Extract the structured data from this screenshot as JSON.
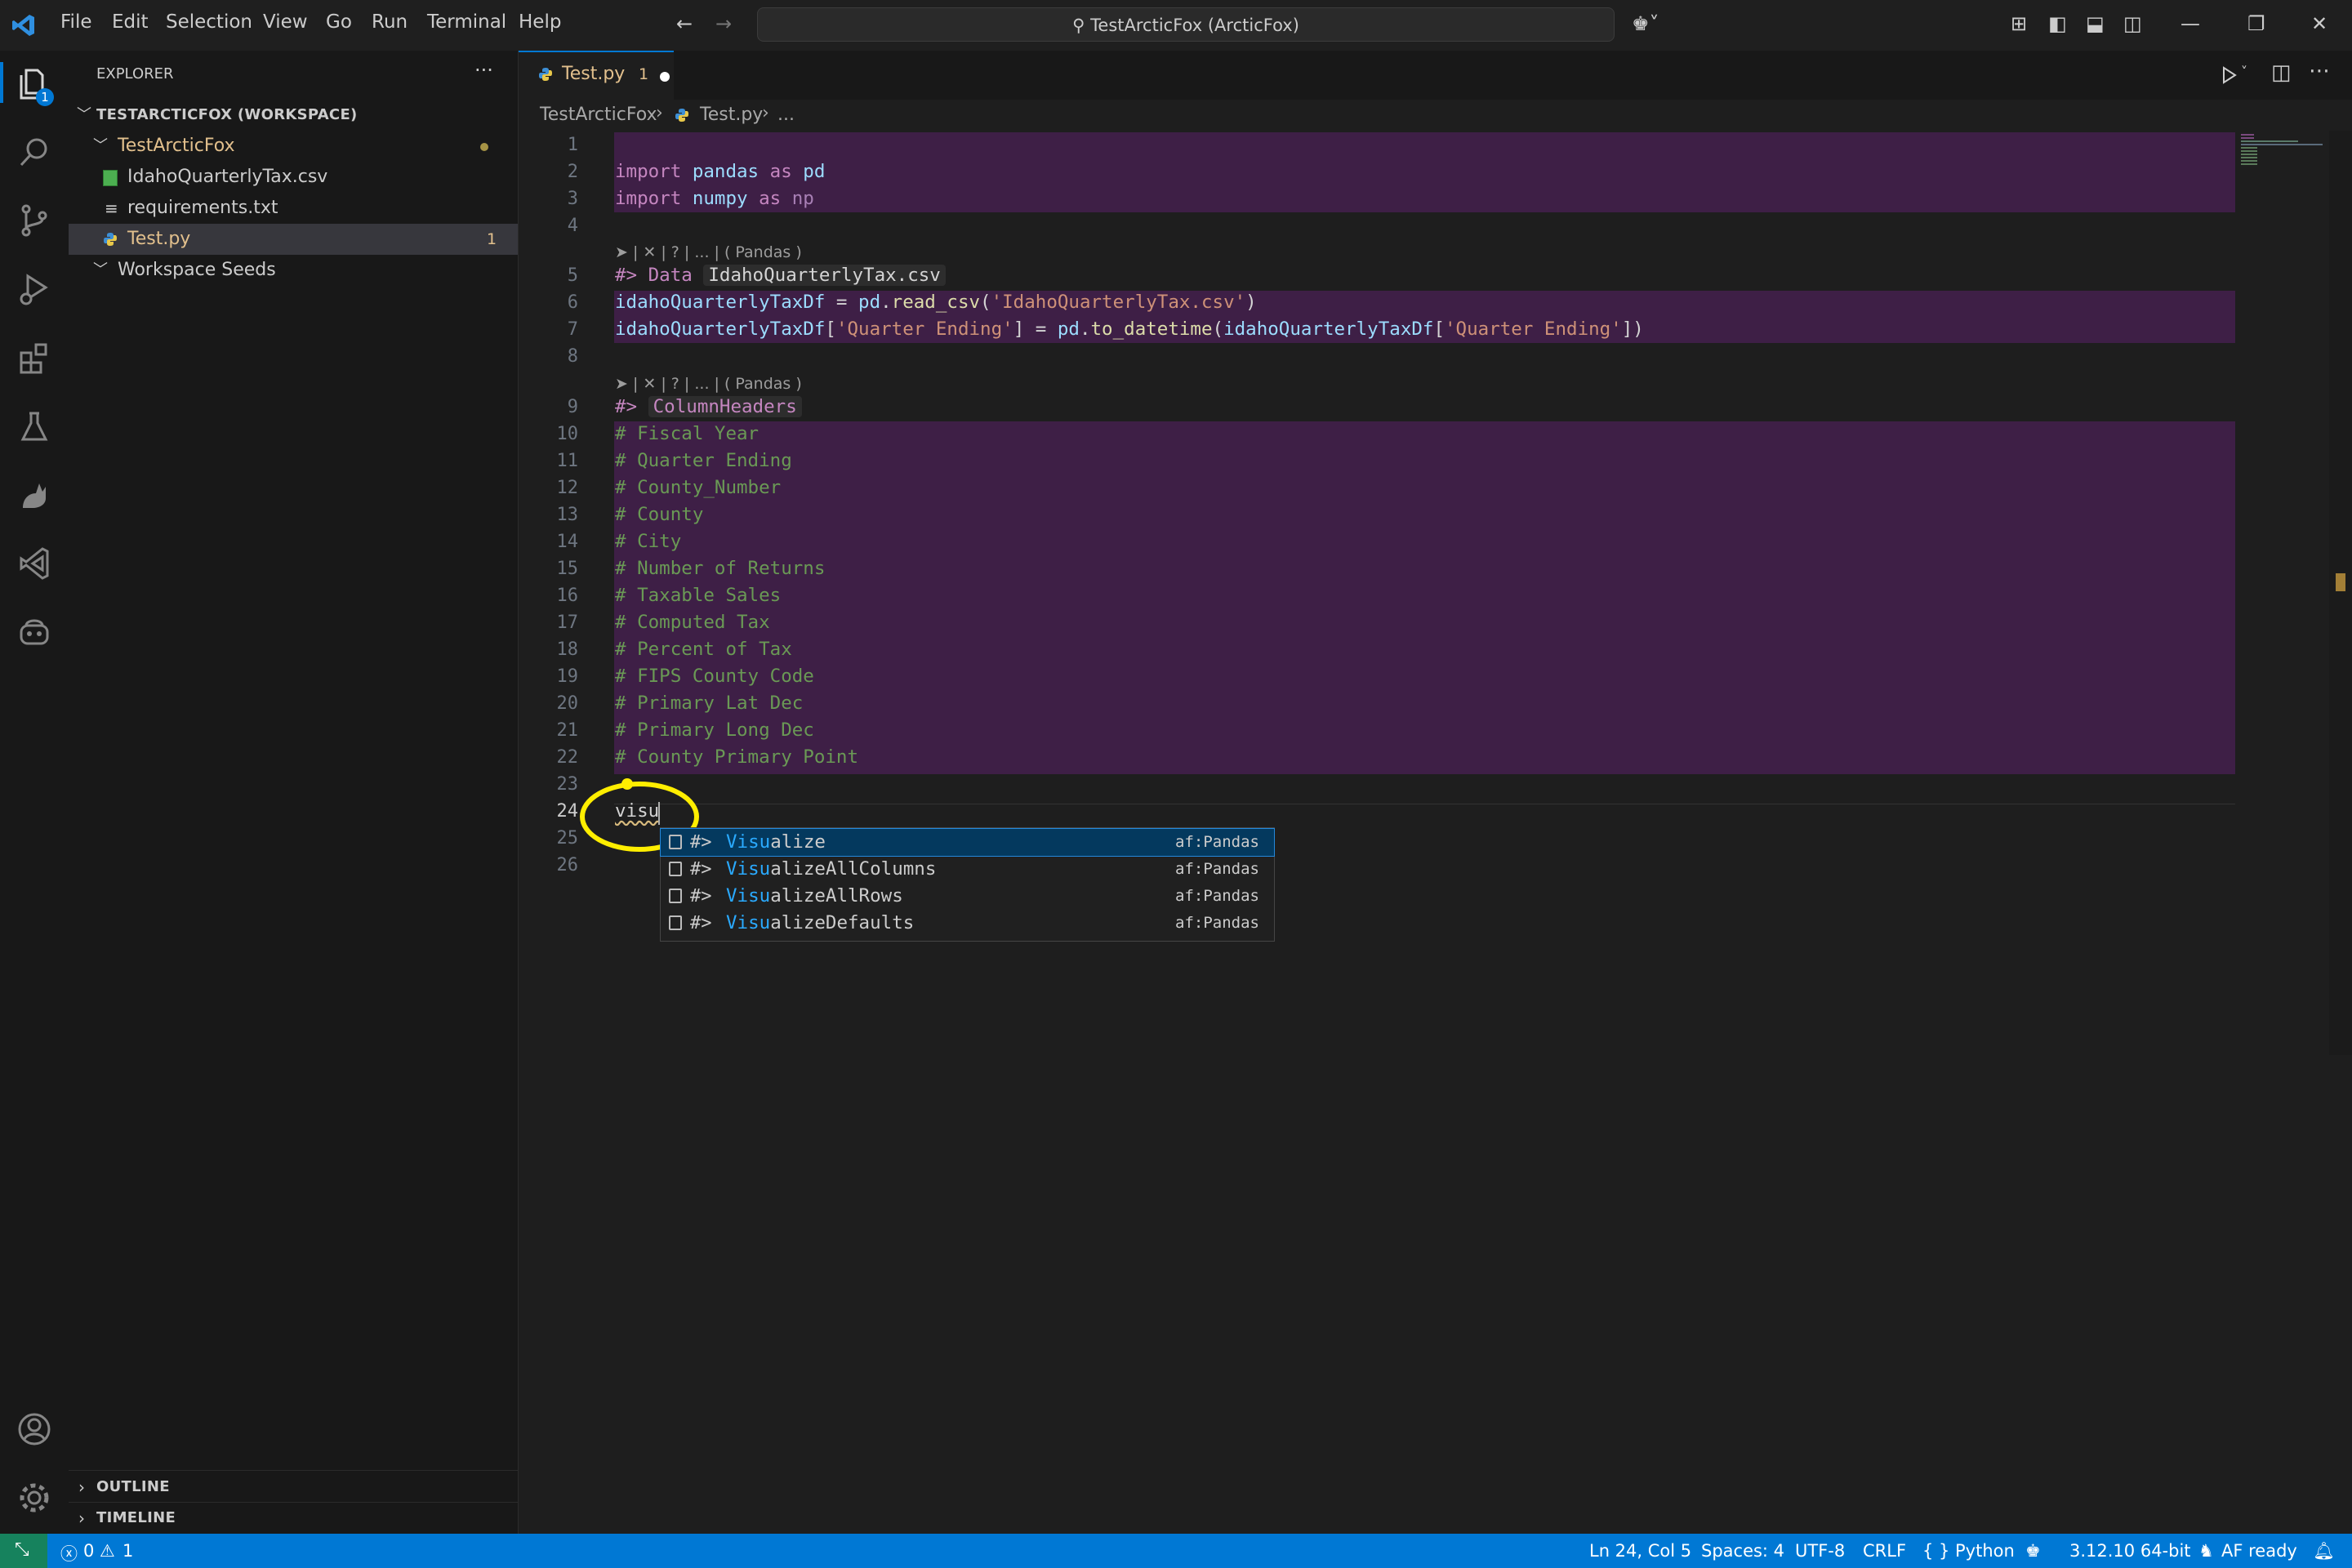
{
  "menu": [
    "File",
    "Edit",
    "Selection",
    "View",
    "Go",
    "Run",
    "Terminal",
    "Help"
  ],
  "window_title": "TestArcticFox (ArcticFox)",
  "activity_badge": "1",
  "sidebar": {
    "title": "EXPLORER",
    "more": "···",
    "workspace": "TESTARCTICFOX (WORKSPACE)",
    "folder": "TestArcticFox",
    "files": [
      {
        "name": "IdahoQuarterlyTax.csv",
        "badge": ""
      },
      {
        "name": "requirements.txt",
        "badge": ""
      },
      {
        "name": "Test.py",
        "badge": "1"
      }
    ],
    "workspace_seeds": "Workspace Seeds",
    "outline": "OUTLINE",
    "timeline": "TIMELINE"
  },
  "tab": {
    "label": "Test.py",
    "problems": "1"
  },
  "breadcrumb": {
    "folder": "TestArcticFox",
    "file": "Test.py",
    "more": "..."
  },
  "lens": "➤ | ✕ | ? | ... | ( Pandas )",
  "code": {
    "l2": {
      "kw": "import",
      "mod": "pandas",
      "as": "as",
      "alias": "pd"
    },
    "l3": {
      "kw": "import",
      "mod": "numpy",
      "as": "as",
      "alias": "np"
    },
    "l5": {
      "tag": "#> Data",
      "arg": "IdahoQuarterlyTax.csv"
    },
    "l6": {
      "var": "idahoQuarterlyTaxDf",
      "eq": " = ",
      "mod": "pd",
      "fn": "read_csv",
      "str": "'IdahoQuarterlyTax.csv'"
    },
    "l7": {
      "var": "idahoQuarterlyTaxDf",
      "str": "'Quarter Ending'",
      "eq": " = ",
      "mod": "pd",
      "fn": "to_datetime",
      "var2": "idahoQuarterlyTaxDf"
    },
    "l9": {
      "tag": "#>",
      "name": "ColumnHeaders"
    },
    "comments": [
      "# Fiscal Year",
      "# Quarter Ending",
      "# County_Number",
      "# County",
      "# City",
      "# Number of Returns",
      "# Taxable Sales",
      "# Computed Tax",
      "# Percent of Tax",
      "# FIPS County Code",
      "# Primary Lat Dec",
      "# Primary Long Dec",
      "# County Primary Point"
    ],
    "l24": "visu"
  },
  "line_numbers": [
    "1",
    "2",
    "3",
    "4",
    "5",
    "6",
    "7",
    "8",
    "9",
    "10",
    "11",
    "12",
    "13",
    "14",
    "15",
    "16",
    "17",
    "18",
    "19",
    "20",
    "21",
    "22",
    "23",
    "24",
    "25",
    "26"
  ],
  "suggestions": [
    {
      "prefix": "#>",
      "match": "Visu",
      "rest": "alize",
      "detail": "af:Pandas"
    },
    {
      "prefix": "#>",
      "match": "Visu",
      "rest": "alizeAllColumns",
      "detail": "af:Pandas"
    },
    {
      "prefix": "#>",
      "match": "Visu",
      "rest": "alizeAllRows",
      "detail": "af:Pandas"
    },
    {
      "prefix": "#>",
      "match": "Visu",
      "rest": "alizeDefaults",
      "detail": "af:Pandas"
    }
  ],
  "status": {
    "errors": "0",
    "warnings": "1",
    "position": "Ln 24, Col 5",
    "spaces": "Spaces: 4",
    "encoding": "UTF-8",
    "eol": "CRLF",
    "language": "Python",
    "interpreter": "3.12.10 64-bit",
    "af": "AF ready"
  },
  "colors": {
    "accent": "#0078d4",
    "cell": "#3e1f46",
    "highlight": "#ffee00",
    "modified": "#e2c08d"
  }
}
